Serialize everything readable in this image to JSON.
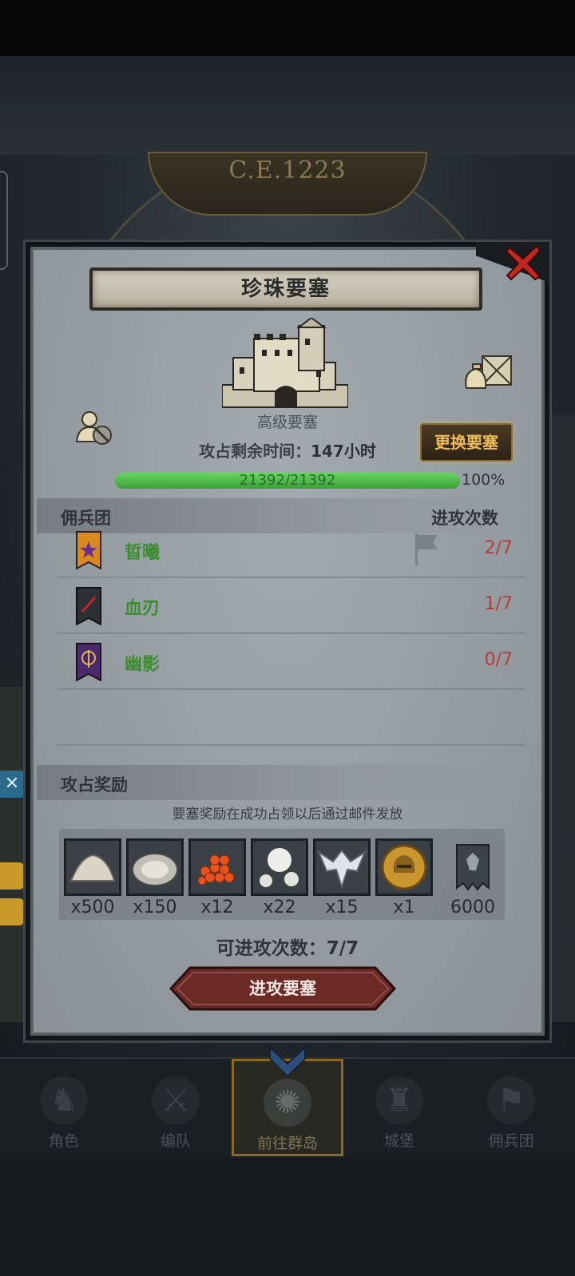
{
  "era_label": "C.E.1223",
  "modal": {
    "title": "珍珠要塞",
    "fortress_level": "高级要塞",
    "occupy_time_label": "攻占剩余时间：",
    "occupy_time_value": "147小时",
    "change_button": "更换要塞",
    "hp": {
      "text": "21392/21392",
      "current": 21392,
      "max": 21392,
      "percent_text": "100%"
    }
  },
  "mercenary_section": {
    "title": "佣兵团",
    "count_header": "进攻次数",
    "rows": [
      {
        "name": "晢曦",
        "count": "2/7",
        "flag_color": "#d98a1e",
        "has_flag_marker": true
      },
      {
        "name": "血刃",
        "count": "1/7",
        "flag_color": "#2c2f33",
        "has_flag_marker": false
      },
      {
        "name": "幽影",
        "count": "0/7",
        "flag_color": "#4a2a6a",
        "has_flag_marker": false
      }
    ]
  },
  "reward_section": {
    "title": "攻占奖励",
    "note": "要塞奖励在成功占领以后通过邮件发放",
    "items": [
      {
        "icon": "salt-pile-icon",
        "qty": "x500"
      },
      {
        "icon": "oyster-icon",
        "qty": "x150"
      },
      {
        "icon": "fish-roe-icon",
        "qty": "x12"
      },
      {
        "icon": "pearls-icon",
        "qty": "x22"
      },
      {
        "icon": "winged-emblem-icon",
        "qty": "x15"
      },
      {
        "icon": "golden-helmet-medal-icon",
        "qty": "x1"
      },
      {
        "icon": "guild-banner-icon",
        "qty": "6000"
      }
    ]
  },
  "attack_remaining": "可进攻次数：7/7",
  "attack_button": "进攻要塞",
  "nav": {
    "items": [
      {
        "label": "角色",
        "icon": "knight-icon"
      },
      {
        "label": "编队",
        "icon": "formation-icon"
      },
      {
        "label": "前往群岛",
        "icon": "island-compass-icon",
        "active": true
      },
      {
        "label": "城堡",
        "icon": "castle-icon"
      },
      {
        "label": "佣兵团",
        "icon": "mercenary-icon"
      }
    ]
  },
  "colors": {
    "hp_green": "#3aa034",
    "merc_name_green": "#3c8d2e",
    "count_red": "#b53c3c",
    "change_button_text": "#f0bc58",
    "attack_button": "#6b2a26"
  }
}
